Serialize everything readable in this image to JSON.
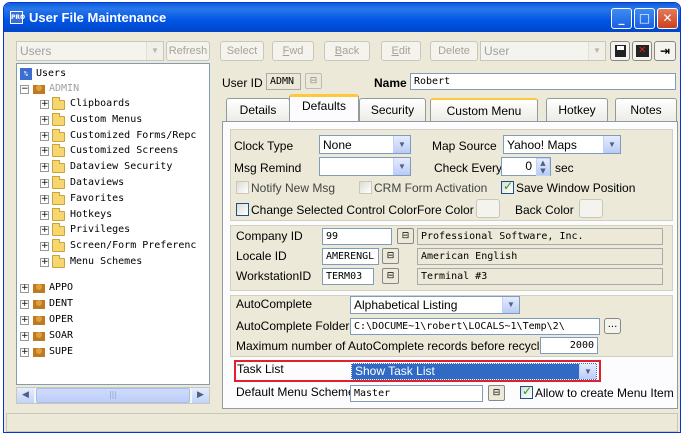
{
  "window": {
    "title": "User File Maintenance",
    "app_badge": "PRO"
  },
  "left": {
    "users_combo": "Users",
    "refresh_label": "Refresh",
    "tree": {
      "root": "Users",
      "admin": "ADMIN",
      "admin_children": [
        "Clipboards",
        "Custom Menus",
        "Customized Forms/Repc",
        "Customized Screens",
        "Dataview Security",
        "Dataviews",
        "Favorites",
        "Hotkeys",
        "Privileges",
        "Screen/Form Preferenc",
        "Menu Schemes"
      ],
      "users": [
        "APPO",
        "DENT",
        "OPER",
        "SOAR",
        "SUPE"
      ]
    },
    "scroll_grip": "|||"
  },
  "toolbar": {
    "select": "Select",
    "fwd_prefix": "",
    "fwd_u": "F",
    "fwd_rest": "wd",
    "back_u": "B",
    "back_rest": "ack",
    "edit_u": "E",
    "edit_rest": "dit",
    "delete": "Delete",
    "user_combo": "User"
  },
  "header": {
    "userid_label": "User ID",
    "userid_value": "ADMN",
    "name_label": "Name",
    "name_value": "Robert"
  },
  "tabs": [
    "Details",
    "Defaults",
    "Security",
    "Custom Menu",
    "Hotkey",
    "Notes"
  ],
  "defaults": {
    "clock_type_label": "Clock Type",
    "clock_type_value": "None",
    "map_source_label": "Map Source",
    "map_source_value": "Yahoo! Maps",
    "msg_remind_label": "Msg Remind",
    "msg_remind_value": "",
    "check_every_label": "Check Every",
    "check_every_value": "0",
    "check_every_unit": "sec",
    "notify_new_msg": "Notify New Msg",
    "crm_form_activation": "CRM Form Activation",
    "save_window_position": "Save Window Position",
    "change_selected_color": "Change Selected Control Color",
    "fore_color": "Fore Color",
    "back_color": "Back Color",
    "company_id_label": "Company ID",
    "company_id_value": "99",
    "company_name": "Professional Software, Inc.",
    "locale_id_label": "Locale ID",
    "locale_id_value": "AMERENGL",
    "locale_name": "American English",
    "workstation_id_label": "WorkstationID",
    "workstation_id_value": "TERM03",
    "workstation_name": "Terminal #3",
    "autocomplete_label": "AutoComplete",
    "autocomplete_value": "Alphabetical Listing",
    "autocomplete_folder_label": "AutoComplete Folder",
    "autocomplete_folder_value": "C:\\DOCUME~1\\robert\\LOCALS~1\\Temp\\2\\",
    "browse_label": "...",
    "max_records_label": "Maximum number of AutoComplete records before recycled",
    "max_records_value": "2000",
    "task_list_label": "Task List",
    "task_list_value": "Show Task List",
    "default_menu_label": "Default Menu Scheme",
    "default_menu_value": "Master",
    "allow_menu_item": "Allow to create Menu Item"
  }
}
